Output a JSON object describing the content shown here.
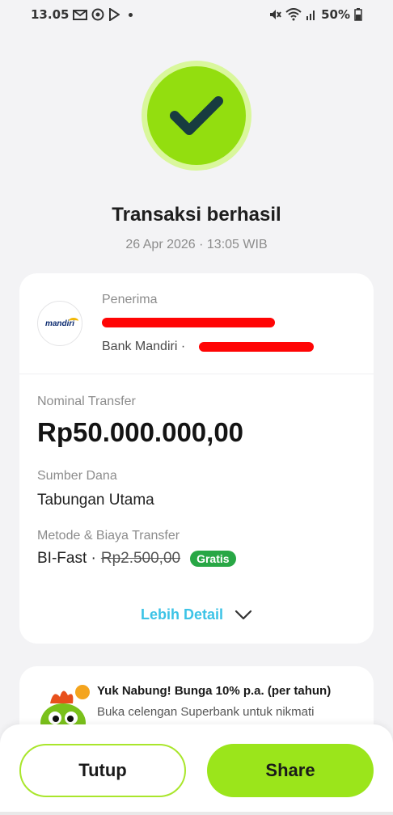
{
  "status_bar": {
    "time": "13.05",
    "battery": "50%",
    "icons": [
      "gmail-icon",
      "target-icon",
      "play-icon",
      "dot-icon",
      "mute-icon",
      "wifi-icon",
      "signal-icon",
      "battery-icon"
    ]
  },
  "header": {
    "title": "Transaksi berhasil",
    "datetime": "26 Apr 2026 · 13:05 WIB"
  },
  "recipient": {
    "label": "Penerima",
    "bank_logo_text": "mandiri",
    "bank_prefix": "Bank Mandiri ·"
  },
  "transfer": {
    "amount_label": "Nominal Transfer",
    "amount": "Rp50.000.000,00",
    "source_label": "Sumber Dana",
    "source_value": "Tabungan Utama",
    "method_label": "Metode & Biaya Transfer",
    "method_value": "BI-Fast ·",
    "fee_original": "Rp2.500,00",
    "fee_badge": "Gratis",
    "more_label": "Lebih Detail"
  },
  "promo": {
    "title": "Yuk Nabung! Bunga 10% p.a. (per tahun)",
    "description": "Buka celengan Superbank untuk nikmati"
  },
  "actions": {
    "close_label": "Tutup",
    "share_label": "Share"
  },
  "colors": {
    "accent_green": "#93de0f",
    "accent_green_light": "#d9f79c",
    "link_blue": "#3cc3e6",
    "badge_green": "#28a745",
    "redaction_red": "#ff0505"
  }
}
